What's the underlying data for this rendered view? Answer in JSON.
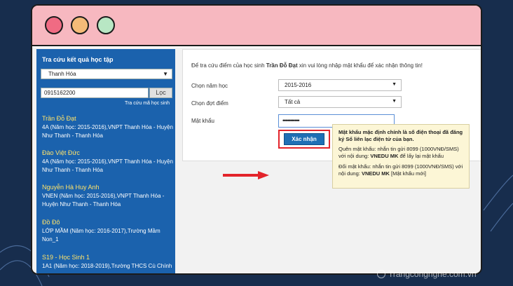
{
  "sidebar": {
    "title": "Tra cứu kết quả học tập",
    "province": "Thanh Hóa",
    "phone": "0915162200",
    "search_button": "Lọc",
    "lookup_link": "Tra cứu mã học sinh",
    "students": [
      {
        "name": "Trần Đỗ Đạt",
        "detail1": "4A (Năm học: 2015-2016),VNPT Thanh Hóa - Huyện",
        "detail2": "Như Thanh - Thanh Hóa"
      },
      {
        "name": "Đào Việt Đức",
        "detail1": "4A (Năm học: 2015-2016),VNPT Thanh Hóa - Huyện",
        "detail2": "Như Thanh - Thanh Hóa"
      },
      {
        "name": "Nguyễn Hà Huy Anh",
        "detail1": "VNEN (Năm học: 2015-2016),VNPT Thanh Hóa -",
        "detail2": "Huyện Như Thanh - Thanh Hóa"
      },
      {
        "name": "Đồ Đô",
        "detail1": "LỚP MẦM (Năm học: 2016-2017),Trường Mầm",
        "detail2": "Non_1"
      },
      {
        "name": "S19 - Học Sinh 1",
        "detail1": "1A1 (Năm học: 2018-2019),Trường THCS Cù Chính",
        "detail2": ""
      }
    ]
  },
  "panel": {
    "intro_prefix": "Để tra cứu điểm của học sinh ",
    "intro_student": "Trần Đỗ Đạt",
    "intro_suffix": " xin vui lòng nhập mật khẩu để xác nhận thông tin!",
    "school_year_label": "Chọn năm học",
    "school_year_value": "2015-2016",
    "term_label": "Chọn đợt điểm",
    "term_value": "Tất cả",
    "password_label": "Mật khẩu",
    "password_value": "•••••••••••",
    "confirm_label": "Xác nhận"
  },
  "tooltip": {
    "line1": "Mật khẩu mặc định chính là số điện thoại đã đăng ký Sổ liên lạc điện tử của bạn.",
    "forgot_pre": "Quên mật khẩu: nhắn tin gửi 8099 (1000VNĐ/SMS) với nội dung: ",
    "forgot_cmd": "VNEDU MK",
    "forgot_post": " để lấy lại mật khẩu",
    "change_pre": "Đổi mật khẩu: nhắn tin gửi 8099 (1000VNĐ/SMS) với nội dung: ",
    "change_cmd": "VNEDU MK",
    "change_post": " [Mật khẩu mới]"
  },
  "watermark": "Trangcongnghe.com.vn",
  "colors": {
    "background": "#172d4d",
    "titlebar": "#f7b8c0",
    "sidebar": "#1b62ad",
    "accent_red": "#e3242b",
    "button_blue": "#1f6fb5"
  }
}
